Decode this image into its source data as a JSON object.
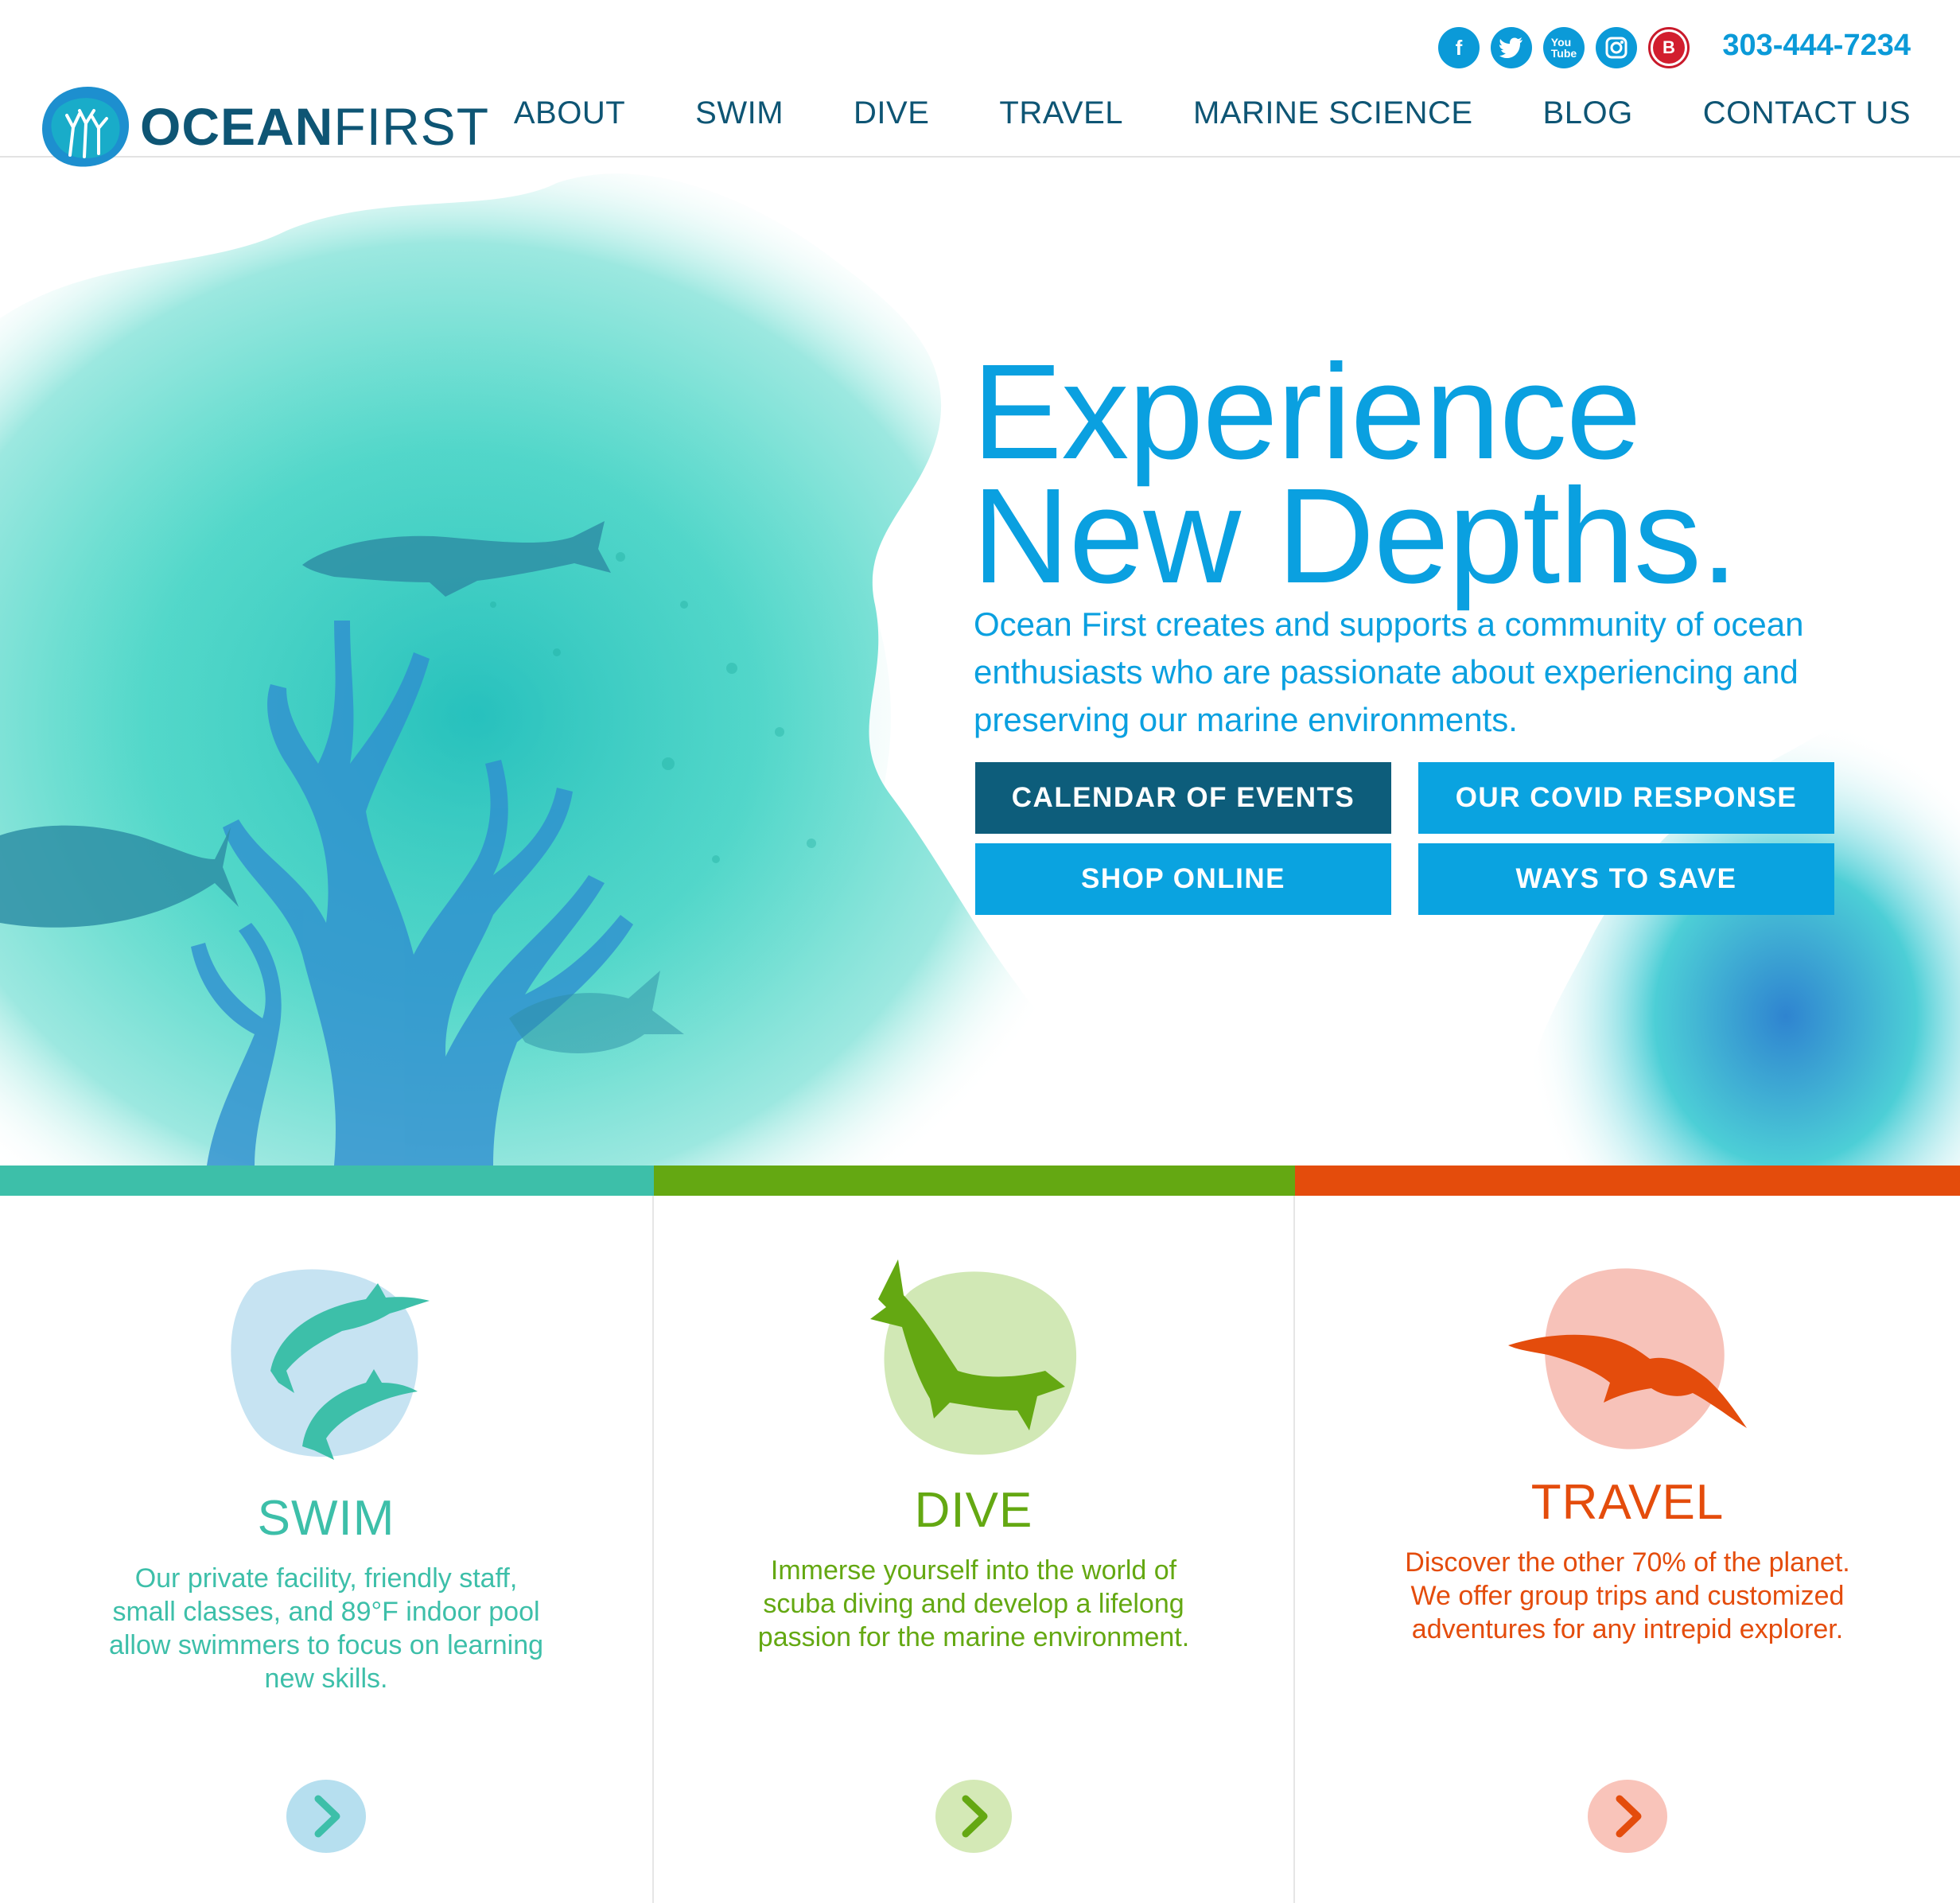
{
  "header": {
    "logo_bold": "OCEAN",
    "logo_light": "FIRST",
    "phone": "303-444-7234",
    "social": [
      {
        "name": "facebook-icon",
        "glyph": "f"
      },
      {
        "name": "twitter-icon",
        "glyph": "t"
      },
      {
        "name": "youtube-icon",
        "glyph": "You"
      },
      {
        "name": "instagram-icon",
        "glyph": "◎"
      },
      {
        "name": "blue-ocean-icon",
        "glyph": "B"
      }
    ],
    "nav": [
      "ABOUT",
      "SWIM",
      "DIVE",
      "TRAVEL",
      "MARINE SCIENCE",
      "BLOG",
      "CONTACT US"
    ]
  },
  "hero": {
    "title_line1": "Experience",
    "title_line2": "New Depths.",
    "subtitle": "Ocean First creates and supports a community of ocean enthusiasts who are passionate about experiencing and preserving our marine environments.",
    "buttons": {
      "calendar": "CALENDAR OF EVENTS",
      "covid": "OUR COVID RESPONSE",
      "shop": "SHOP ONLINE",
      "save": "WAYS TO SAVE"
    }
  },
  "colors": {
    "teal": "#3dbfa9",
    "green": "#64a812",
    "orange": "#e44c0c",
    "hero_blue": "#0aa0e0",
    "navy": "#0d5d7b"
  },
  "cards": {
    "swim": {
      "title": "SWIM",
      "text": "Our private facility, friendly staff, small classes, and 89°F indoor pool allow swimmers to focus on learning new skills.",
      "icon": "dolphins-icon"
    },
    "dive": {
      "title": "DIVE",
      "text": "Immerse yourself into the world of scuba diving and develop a lifelong passion for the marine environment.",
      "icon": "whale-icon"
    },
    "travel": {
      "title": "TRAVEL",
      "text": "Discover the other 70% of the planet. We offer group trips and customized adventures for any intrepid explorer.",
      "icon": "bird-icon"
    }
  }
}
